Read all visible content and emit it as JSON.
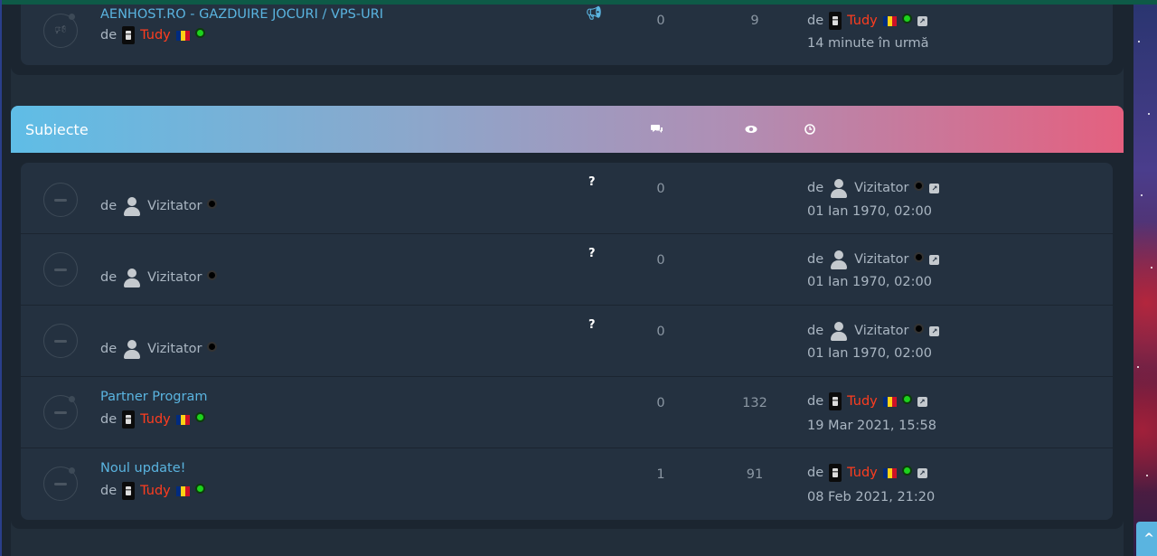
{
  "announcement_row": {
    "title": "AENHOST.RO - GAZDUIRE JOCURI / VPS-URI",
    "by": "de",
    "author": "Tudy",
    "replies": "0",
    "views": "9",
    "last_by": "de",
    "last_user": "Tudy",
    "last_time": "14 minute în urmă",
    "type_icon": "megaphone-icon"
  },
  "section": {
    "title": "Subiecte",
    "col_icons": [
      "comments-icon",
      "eye-icon",
      "clock-icon"
    ]
  },
  "topics": [
    {
      "title": "",
      "by": "de",
      "author": "Vizitator",
      "author_type": "guest",
      "type_icon": "?",
      "replies": "0",
      "views": "",
      "last_by": "de",
      "last_user": "Vizitator",
      "last_user_type": "guest",
      "last_time": "01 Ian 1970, 02:00"
    },
    {
      "title": "",
      "by": "de",
      "author": "Vizitator",
      "author_type": "guest",
      "type_icon": "?",
      "replies": "0",
      "views": "",
      "last_by": "de",
      "last_user": "Vizitator",
      "last_user_type": "guest",
      "last_time": "01 Ian 1970, 02:00"
    },
    {
      "title": "",
      "by": "de",
      "author": "Vizitator",
      "author_type": "guest",
      "type_icon": "?",
      "replies": "0",
      "views": "",
      "last_by": "de",
      "last_user": "Vizitator",
      "last_user_type": "guest",
      "last_time": "01 Ian 1970, 02:00"
    },
    {
      "title": "Partner Program",
      "by": "de",
      "author": "Tudy",
      "author_type": "admin",
      "type_icon": "",
      "replies": "0",
      "views": "132",
      "last_by": "de",
      "last_user": "Tudy",
      "last_user_type": "admin",
      "last_time": "19 Mar 2021, 15:58"
    },
    {
      "title": "Noul update!",
      "by": "de",
      "author": "Tudy",
      "author_type": "admin",
      "type_icon": "",
      "replies": "1",
      "views": "91",
      "last_by": "de",
      "last_user": "Tudy",
      "last_user_type": "admin",
      "last_time": "08 Feb 2021, 21:20"
    }
  ],
  "colors": {
    "link": "#5ab4e0",
    "admin_name": "#ff3d1f",
    "online": "#1dd31d",
    "header_gradient_start": "#5fbde6",
    "header_gradient_end": "#e4607f"
  },
  "scroll_top_icon": "^"
}
